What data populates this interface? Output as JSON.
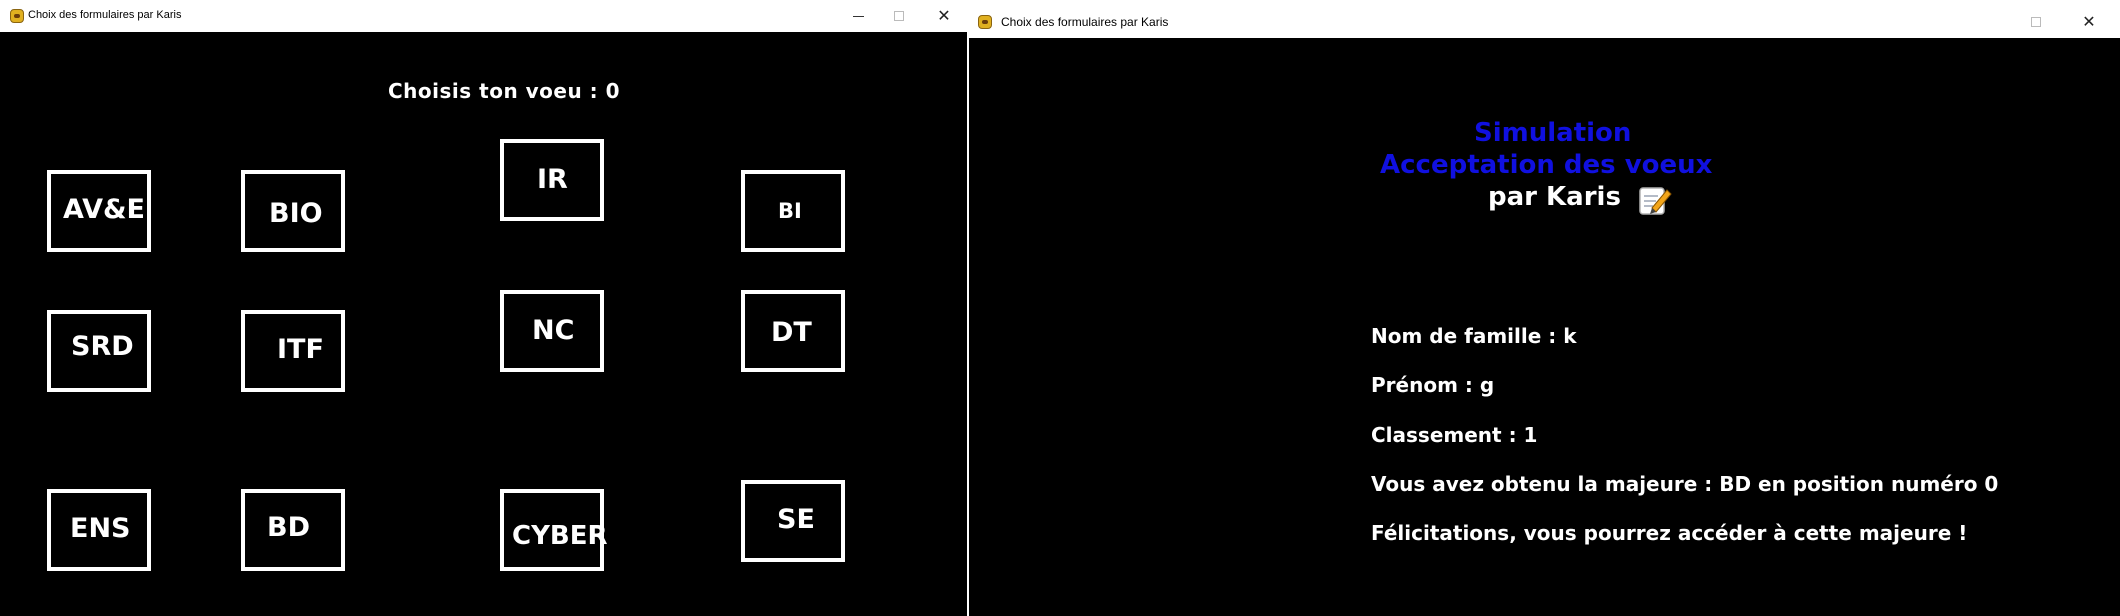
{
  "left_window": {
    "title": "Choix des formulaires par Karis",
    "close_glyph": "✕",
    "prompt": "Choisis ton voeu : 0",
    "options": [
      "AV&E",
      "BIO",
      "IR",
      "BI",
      "SRD",
      "ITF",
      "NC",
      "DT",
      "ENS",
      "BD",
      "CYBER",
      "SE"
    ]
  },
  "right_window": {
    "title": "Choix des formulaires par Karis",
    "close_glyph": "✕",
    "heading_line1": "Simulation",
    "heading_line2": "Acceptation des voeux",
    "author_line": "par Karis",
    "author_icon": "memo-icon",
    "accent_color": "#1010e0",
    "info": {
      "nom": "Nom de famille : k",
      "prenom": "Prénom : g",
      "classement": "Classement : 1",
      "resultat": "Vous avez obtenu la majeure : BD en position numéro 0",
      "felicitations": "Félicitations, vous pourrez accéder à cette majeure !"
    }
  }
}
